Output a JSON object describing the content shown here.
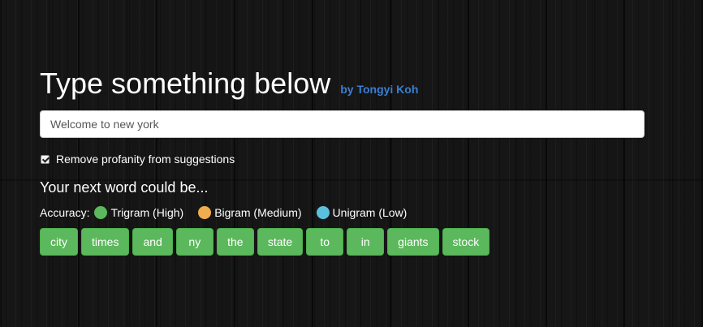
{
  "header": {
    "title": "Type something below",
    "byline": "by Tongyi Koh"
  },
  "input": {
    "value": "Welcome to new york",
    "placeholder": ""
  },
  "profanity_filter": {
    "label": "Remove profanity from suggestions",
    "checked": true
  },
  "suggestions_heading": "Your next word could be...",
  "accuracy": {
    "label": "Accuracy:",
    "levels": [
      {
        "label": "Trigram (High)",
        "color": "#5cb85c"
      },
      {
        "label": "Bigram (Medium)",
        "color": "#f0ad4e"
      },
      {
        "label": "Unigram (Low)",
        "color": "#5bc0de"
      }
    ]
  },
  "suggestions": [
    {
      "word": "city"
    },
    {
      "word": "times"
    },
    {
      "word": "and"
    },
    {
      "word": "ny"
    },
    {
      "word": "the"
    },
    {
      "word": "state"
    },
    {
      "word": "to"
    },
    {
      "word": "in"
    },
    {
      "word": "giants"
    },
    {
      "word": "stock"
    }
  ],
  "colors": {
    "byline": "#3a7fd1",
    "suggestion_button": "#5cb85c"
  }
}
